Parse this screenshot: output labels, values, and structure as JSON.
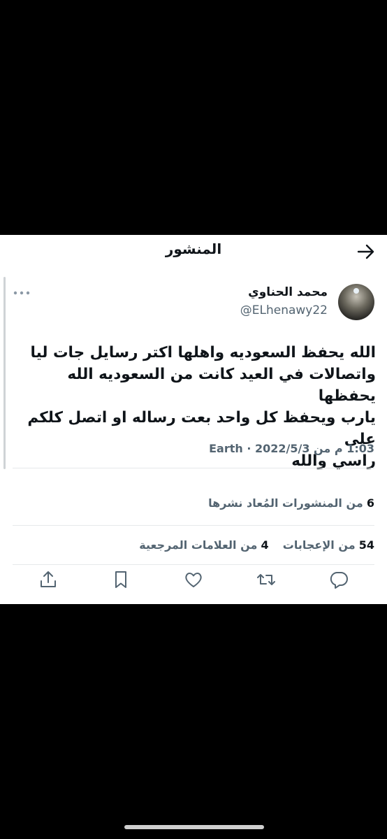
{
  "header": {
    "title": "المنشور"
  },
  "tweet": {
    "display_name": "محمد الحناوي",
    "handle": "@ELhenawy22",
    "text_lines": [
      "الله يحفظ السعوديه واهلها اكتر رسايل جات ليا",
      "واتصالات في العيد كانت من السعوديه الله يحفظها",
      "يارب ويحفظ كل واحد بعت رساله او اتصل كلكم على",
      "راسي والله"
    ],
    "meta": "1:03 م من Earth · 2022/5/3"
  },
  "stats": {
    "reposts_count": "6",
    "reposts_label": "من المنشورات المُعاد نشرها",
    "likes_count": "54",
    "likes_label": "من الإعجابات",
    "bookmarks_count": "4",
    "bookmarks_label": "من العلامات المرجعية"
  },
  "icons": {
    "back": "arrow-right-icon",
    "more": "more-dots-icon",
    "reply": "reply-icon",
    "retweet": "retweet-icon",
    "like": "heart-icon",
    "bookmark": "bookmark-icon",
    "share": "share-icon"
  },
  "colors": {
    "text_primary": "#0f1419",
    "text_secondary": "#536471",
    "background": "#ffffff",
    "frame": "#000000"
  }
}
